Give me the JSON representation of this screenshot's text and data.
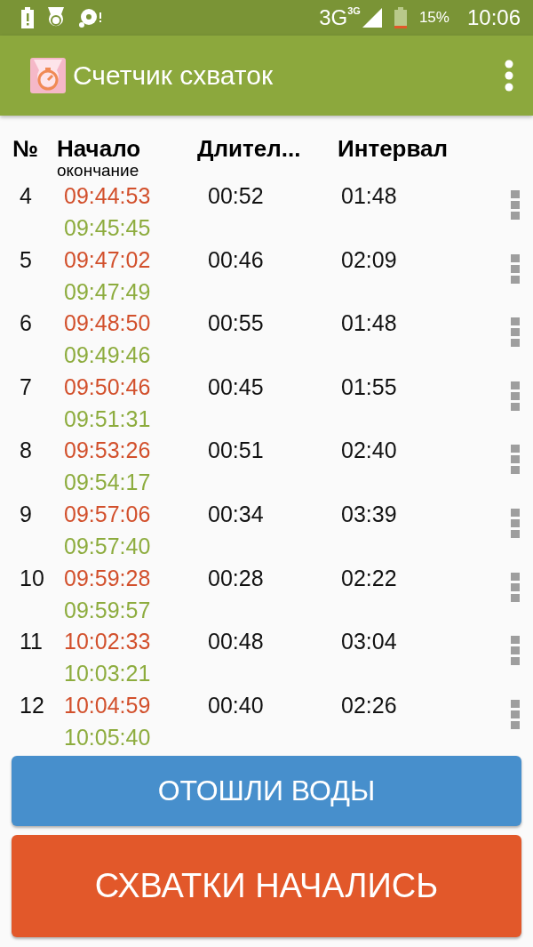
{
  "status_bar": {
    "network": "3G",
    "network_badge": "3G",
    "battery": "15%",
    "time": "10:06"
  },
  "app_bar": {
    "title": "Счетчик схваток"
  },
  "table": {
    "columns": [
      {
        "label": "№"
      },
      {
        "label": "Начало",
        "sublabel": "окончание"
      },
      {
        "label": "Длител..."
      },
      {
        "label": "Интервал"
      }
    ],
    "rows": [
      {
        "number": "4",
        "start": "09:44:53",
        "end": "09:45:45",
        "duration": "00:52",
        "interval": "01:48"
      },
      {
        "number": "5",
        "start": "09:47:02",
        "end": "09:47:49",
        "duration": "00:46",
        "interval": "02:09"
      },
      {
        "number": "6",
        "start": "09:48:50",
        "end": "09:49:46",
        "duration": "00:55",
        "interval": "01:48"
      },
      {
        "number": "7",
        "start": "09:50:46",
        "end": "09:51:31",
        "duration": "00:45",
        "interval": "01:55"
      },
      {
        "number": "8",
        "start": "09:53:26",
        "end": "09:54:17",
        "duration": "00:51",
        "interval": "02:40"
      },
      {
        "number": "9",
        "start": "09:57:06",
        "end": "09:57:40",
        "duration": "00:34",
        "interval": "03:39"
      },
      {
        "number": "10",
        "start": "09:59:28",
        "end": "09:59:57",
        "duration": "00:28",
        "interval": "02:22"
      },
      {
        "number": "11",
        "start": "10:02:33",
        "end": "10:03:21",
        "duration": "00:48",
        "interval": "03:04"
      },
      {
        "number": "12",
        "start": "10:04:59",
        "end": "10:05:40",
        "duration": "00:40",
        "interval": "02:26"
      }
    ]
  },
  "buttons": [
    {
      "label": "ОТОШЛИ ВОДЫ",
      "color": "#478fcc"
    },
    {
      "label": "СХВАТКИ НАЧАЛИСЬ",
      "color": "#e2582a"
    }
  ]
}
